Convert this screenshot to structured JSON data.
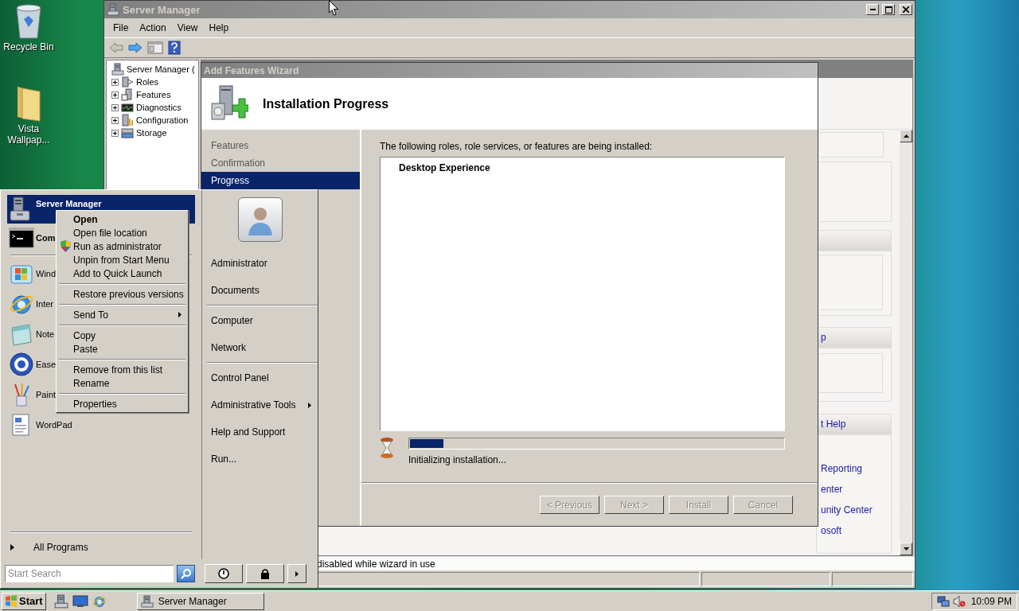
{
  "desktop_icons": [
    {
      "label": "Recycle Bin",
      "kind": "bin"
    },
    {
      "label": "Vista Wallpap...",
      "kind": "folder"
    }
  ],
  "server_manager": {
    "title": "Server Manager",
    "menu": [
      "File",
      "Action",
      "View",
      "Help"
    ],
    "tree": {
      "label": "Server Manager (",
      "children": [
        {
          "label": "Roles",
          "kind": "roles",
          "expanded": false
        },
        {
          "label": "Features",
          "kind": "features",
          "expanded": false
        },
        {
          "label": "Diagnostics",
          "kind": "diagnostics",
          "expanded": false
        },
        {
          "label": "Configuration",
          "kind": "configuration",
          "expanded": false
        },
        {
          "label": "Storage",
          "kind": "storage",
          "expanded": false
        }
      ]
    },
    "pane_headings": [
      "p",
      "t Help"
    ],
    "pane_links": [
      "Reporting",
      "enter",
      "unity Center",
      "osoft"
    ],
    "status": "disabled while wizard in use"
  },
  "wizard": {
    "title": "Add Features Wizard",
    "heading": "Installation Progress",
    "steps": [
      {
        "label": "Features",
        "selected": false
      },
      {
        "label": "Confirmation",
        "selected": false
      },
      {
        "label": "Progress",
        "selected": true
      }
    ],
    "intro": "The following roles, role services, or features are being installed:",
    "items": [
      "Desktop Experience"
    ],
    "progress": {
      "level": 0.09
    },
    "status": "Initializing installation...",
    "buttons": [
      {
        "label": "< Previous",
        "disabled": true
      },
      {
        "label": "Next >",
        "disabled": true
      },
      {
        "label": "Install",
        "disabled": true
      },
      {
        "label": "Cancel",
        "disabled": true
      }
    ]
  },
  "start_menu": {
    "pinned": [
      {
        "label": "Server Manager",
        "kind": "server",
        "selected": true
      },
      {
        "label": "Com",
        "kind": "console",
        "selected": false
      }
    ],
    "recent": [
      {
        "label": "Wind",
        "kind": "update"
      },
      {
        "label": "Inter",
        "kind": "browser"
      },
      {
        "label": "Note",
        "kind": "notepad"
      },
      {
        "label": "Ease",
        "kind": "ease"
      },
      {
        "label": "Paint",
        "kind": "paint"
      },
      {
        "label": "WordPad",
        "kind": "wordpad"
      }
    ],
    "all_programs": "All Programs",
    "search": {
      "placeholder": "Start Search"
    },
    "places": [
      [
        {
          "label": "Administrator",
          "submenu": false
        },
        {
          "label": "Documents",
          "submenu": false
        }
      ],
      [
        {
          "label": "Computer",
          "submenu": false
        },
        {
          "label": "Network",
          "submenu": false
        }
      ],
      [
        {
          "label": "Control Panel",
          "submenu": false
        },
        {
          "label": "Administrative Tools",
          "submenu": true
        },
        {
          "label": "Help and Support",
          "submenu": false
        },
        {
          "label": "Run...",
          "submenu": false
        }
      ]
    ]
  },
  "context_menu": [
    [
      {
        "label": "Open",
        "kind": "default"
      },
      {
        "label": "Open file location",
        "kind": "item"
      },
      {
        "label": "Run as administrator",
        "kind": "shield"
      },
      {
        "label": "Unpin from Start Menu",
        "kind": "item"
      },
      {
        "label": "Add to Quick Launch",
        "kind": "item"
      }
    ],
    [
      {
        "label": "Restore previous versions",
        "kind": "item"
      }
    ],
    [
      {
        "label": "Send To",
        "kind": "submenu"
      }
    ],
    [
      {
        "label": "Copy",
        "kind": "item"
      },
      {
        "label": "Paste",
        "kind": "item"
      }
    ],
    [
      {
        "label": "Remove from this list",
        "kind": "item"
      },
      {
        "label": "Rename",
        "kind": "item"
      }
    ],
    [
      {
        "label": "Properties",
        "kind": "item"
      }
    ]
  ],
  "taskbar": {
    "start": "Start",
    "tasks": [
      {
        "label": "Server Manager",
        "selected": false
      }
    ],
    "clock": "10:09 PM"
  }
}
